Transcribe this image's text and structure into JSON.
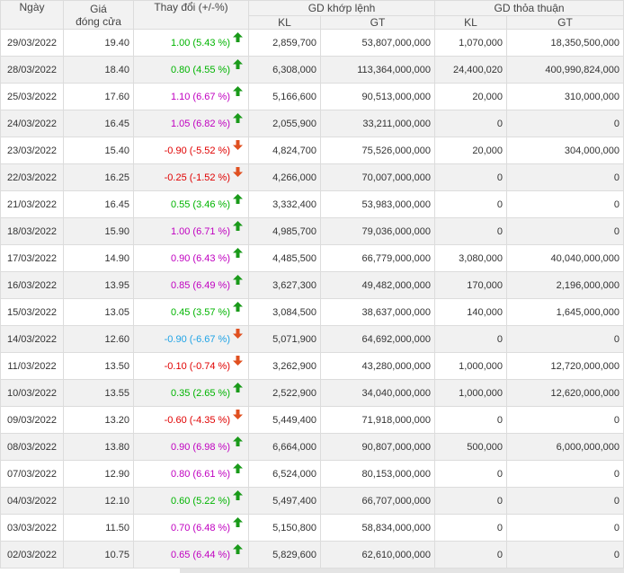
{
  "headers": {
    "date": "Ngày",
    "close_line1": "Giá",
    "close_line2": "đóng cửa",
    "change": "Thay đổi (+/-%)",
    "matched": "GD khớp lệnh",
    "negotiated": "GD thỏa thuận",
    "kl": "KL",
    "gt": "GT"
  },
  "colors": {
    "up": "#00b400",
    "ceiling": "#c000c0",
    "down": "#e00000",
    "floor": "#1fa3e6"
  },
  "rows": [
    {
      "date": "29/03/2022",
      "close": "19.40",
      "change": "1.00 (5.43 %)",
      "dir": "up",
      "kl": "2,859,700",
      "gt": "53,807,000,000",
      "tt_kl": "1,070,000",
      "tt_gt": "18,350,500,000"
    },
    {
      "date": "28/03/2022",
      "close": "18.40",
      "change": "0.80 (4.55 %)",
      "dir": "up",
      "kl": "6,308,000",
      "gt": "113,364,000,000",
      "tt_kl": "24,400,020",
      "tt_gt": "400,990,824,000"
    },
    {
      "date": "25/03/2022",
      "close": "17.60",
      "change": "1.10 (6.67 %)",
      "dir": "ceiling",
      "kl": "5,166,600",
      "gt": "90,513,000,000",
      "tt_kl": "20,000",
      "tt_gt": "310,000,000"
    },
    {
      "date": "24/03/2022",
      "close": "16.45",
      "change": "1.05 (6.82 %)",
      "dir": "ceiling",
      "kl": "2,055,900",
      "gt": "33,211,000,000",
      "tt_kl": "0",
      "tt_gt": "0"
    },
    {
      "date": "23/03/2022",
      "close": "15.40",
      "change": "-0.90 (-5.52 %)",
      "dir": "down",
      "kl": "4,824,700",
      "gt": "75,526,000,000",
      "tt_kl": "20,000",
      "tt_gt": "304,000,000"
    },
    {
      "date": "22/03/2022",
      "close": "16.25",
      "change": "-0.25 (-1.52 %)",
      "dir": "down",
      "kl": "4,266,000",
      "gt": "70,007,000,000",
      "tt_kl": "0",
      "tt_gt": "0"
    },
    {
      "date": "21/03/2022",
      "close": "16.45",
      "change": "0.55 (3.46 %)",
      "dir": "up",
      "kl": "3,332,400",
      "gt": "53,983,000,000",
      "tt_kl": "0",
      "tt_gt": "0"
    },
    {
      "date": "18/03/2022",
      "close": "15.90",
      "change": "1.00 (6.71 %)",
      "dir": "ceiling",
      "kl": "4,985,700",
      "gt": "79,036,000,000",
      "tt_kl": "0",
      "tt_gt": "0"
    },
    {
      "date": "17/03/2022",
      "close": "14.90",
      "change": "0.90 (6.43 %)",
      "dir": "ceiling",
      "kl": "4,485,500",
      "gt": "66,779,000,000",
      "tt_kl": "3,080,000",
      "tt_gt": "40,040,000,000"
    },
    {
      "date": "16/03/2022",
      "close": "13.95",
      "change": "0.85 (6.49 %)",
      "dir": "ceiling",
      "kl": "3,627,300",
      "gt": "49,482,000,000",
      "tt_kl": "170,000",
      "tt_gt": "2,196,000,000"
    },
    {
      "date": "15/03/2022",
      "close": "13.05",
      "change": "0.45 (3.57 %)",
      "dir": "up",
      "kl": "3,084,500",
      "gt": "38,637,000,000",
      "tt_kl": "140,000",
      "tt_gt": "1,645,000,000"
    },
    {
      "date": "14/03/2022",
      "close": "12.60",
      "change": "-0.90 (-6.67 %)",
      "dir": "floor",
      "kl": "5,071,900",
      "gt": "64,692,000,000",
      "tt_kl": "0",
      "tt_gt": "0"
    },
    {
      "date": "11/03/2022",
      "close": "13.50",
      "change": "-0.10 (-0.74 %)",
      "dir": "down",
      "kl": "3,262,900",
      "gt": "43,280,000,000",
      "tt_kl": "1,000,000",
      "tt_gt": "12,720,000,000"
    },
    {
      "date": "10/03/2022",
      "close": "13.55",
      "change": "0.35 (2.65 %)",
      "dir": "up",
      "kl": "2,522,900",
      "gt": "34,040,000,000",
      "tt_kl": "1,000,000",
      "tt_gt": "12,620,000,000"
    },
    {
      "date": "09/03/2022",
      "close": "13.20",
      "change": "-0.60 (-4.35 %)",
      "dir": "down",
      "kl": "5,449,400",
      "gt": "71,918,000,000",
      "tt_kl": "0",
      "tt_gt": "0"
    },
    {
      "date": "08/03/2022",
      "close": "13.80",
      "change": "0.90 (6.98 %)",
      "dir": "ceiling",
      "kl": "6,664,000",
      "gt": "90,807,000,000",
      "tt_kl": "500,000",
      "tt_gt": "6,000,000,000"
    },
    {
      "date": "07/03/2022",
      "close": "12.90",
      "change": "0.80 (6.61 %)",
      "dir": "ceiling",
      "kl": "6,524,000",
      "gt": "80,153,000,000",
      "tt_kl": "0",
      "tt_gt": "0"
    },
    {
      "date": "04/03/2022",
      "close": "12.10",
      "change": "0.60 (5.22 %)",
      "dir": "up",
      "kl": "5,497,400",
      "gt": "66,707,000,000",
      "tt_kl": "0",
      "tt_gt": "0"
    },
    {
      "date": "03/03/2022",
      "close": "11.50",
      "change": "0.70 (6.48 %)",
      "dir": "ceiling",
      "kl": "5,150,800",
      "gt": "58,834,000,000",
      "tt_kl": "0",
      "tt_gt": "0"
    },
    {
      "date": "02/03/2022",
      "close": "10.75",
      "change": "0.65 (6.44 %)",
      "dir": "ceiling",
      "kl": "5,829,600",
      "gt": "62,610,000,000",
      "tt_kl": "0",
      "tt_gt": "0"
    }
  ]
}
